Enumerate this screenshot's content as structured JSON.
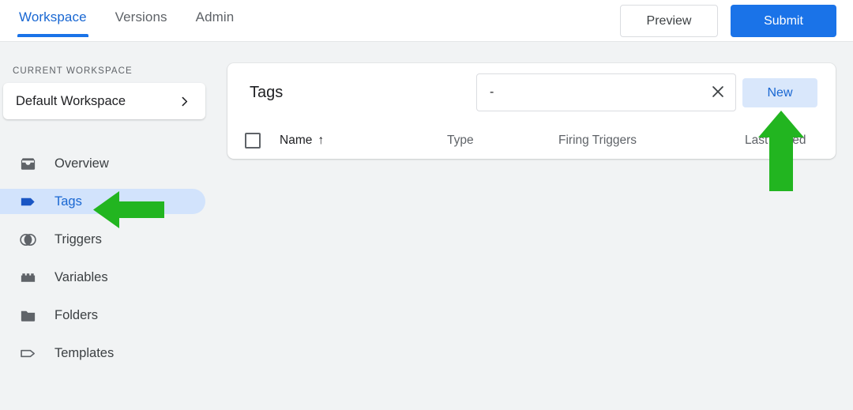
{
  "topbar": {
    "tabs": [
      {
        "label": "Workspace",
        "active": true
      },
      {
        "label": "Versions",
        "active": false
      },
      {
        "label": "Admin",
        "active": false
      }
    ],
    "preview_label": "Preview",
    "submit_label": "Submit",
    "accent_color": "#1a73e8"
  },
  "sidebar": {
    "section_label": "CURRENT WORKSPACE",
    "workspace_name": "Default Workspace",
    "items": [
      {
        "label": "Overview",
        "icon": "inbox-icon",
        "active": false
      },
      {
        "label": "Tags",
        "icon": "tag-icon",
        "active": true
      },
      {
        "label": "Triggers",
        "icon": "triggers-icon",
        "active": false
      },
      {
        "label": "Variables",
        "icon": "variables-icon",
        "active": false
      },
      {
        "label": "Folders",
        "icon": "folder-icon",
        "active": false
      },
      {
        "label": "Templates",
        "icon": "template-icon",
        "active": false
      }
    ],
    "active_bg_color": "#d2e3fc",
    "active_text_color": "#1967d2"
  },
  "main": {
    "card_title": "Tags",
    "search": {
      "value": "-",
      "placeholder": "",
      "clear_icon": "close-icon"
    },
    "new_button_label": "New",
    "table": {
      "select_all_checked": false,
      "columns": [
        {
          "label": "Name",
          "sorted": true,
          "sort_direction": "↑"
        },
        {
          "label": "Type",
          "sorted": false
        },
        {
          "label": "Firing Triggers",
          "sorted": false
        },
        {
          "label": "Last Edited",
          "sorted": false
        }
      ],
      "rows": []
    }
  },
  "annotations": {
    "arrow_color": "#22b520",
    "arrows": [
      {
        "name": "arrow-pointing-to-tags",
        "direction": "left"
      },
      {
        "name": "arrow-pointing-to-new-button",
        "direction": "up"
      }
    ]
  }
}
